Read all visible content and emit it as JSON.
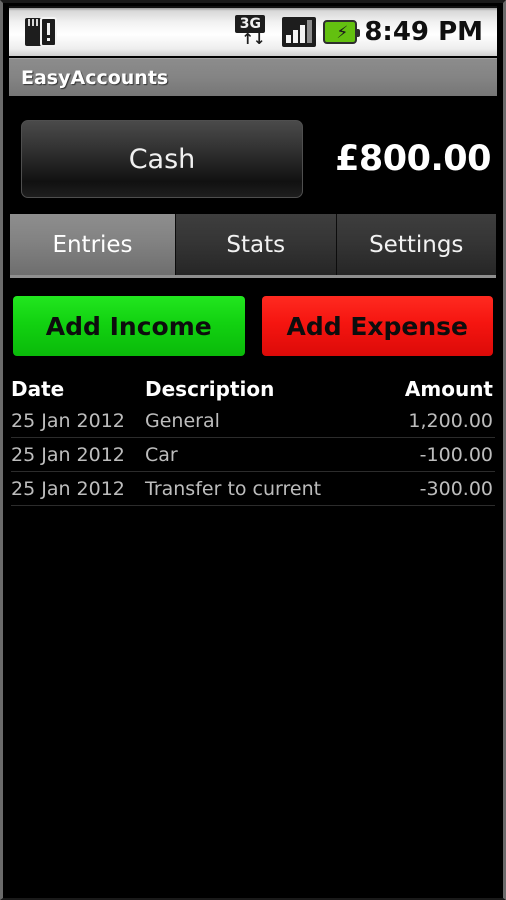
{
  "status_bar": {
    "sd_card_icon": "sd-card-warning-icon",
    "network_icon": "3g-data-icon",
    "network_label": "3G",
    "network_arrows": "↑↓",
    "signal_icon": "signal-bars-icon",
    "battery_icon": "battery-charging-icon",
    "battery_bolt": "⚡",
    "time": "8:49 PM"
  },
  "title_bar": {
    "app_name": "EasyAccounts"
  },
  "account": {
    "name": "Cash",
    "balance": "£800.00"
  },
  "tabs": [
    {
      "label": "Entries",
      "selected": true
    },
    {
      "label": "Stats",
      "selected": false
    },
    {
      "label": "Settings",
      "selected": false
    }
  ],
  "actions": {
    "add_income": "Add Income",
    "add_expense": "Add Expense",
    "income_color": "#12d211",
    "expense_color": "#f51510"
  },
  "entries_table": {
    "headers": {
      "date": "Date",
      "description": "Description",
      "amount": "Amount"
    },
    "rows": [
      {
        "date": "25 Jan 2012",
        "description": "General",
        "amount": "1,200.00"
      },
      {
        "date": "25 Jan 2012",
        "description": "Car",
        "amount": "-100.00"
      },
      {
        "date": "25 Jan 2012",
        "description": "Transfer to current",
        "amount": "-300.00"
      }
    ]
  }
}
